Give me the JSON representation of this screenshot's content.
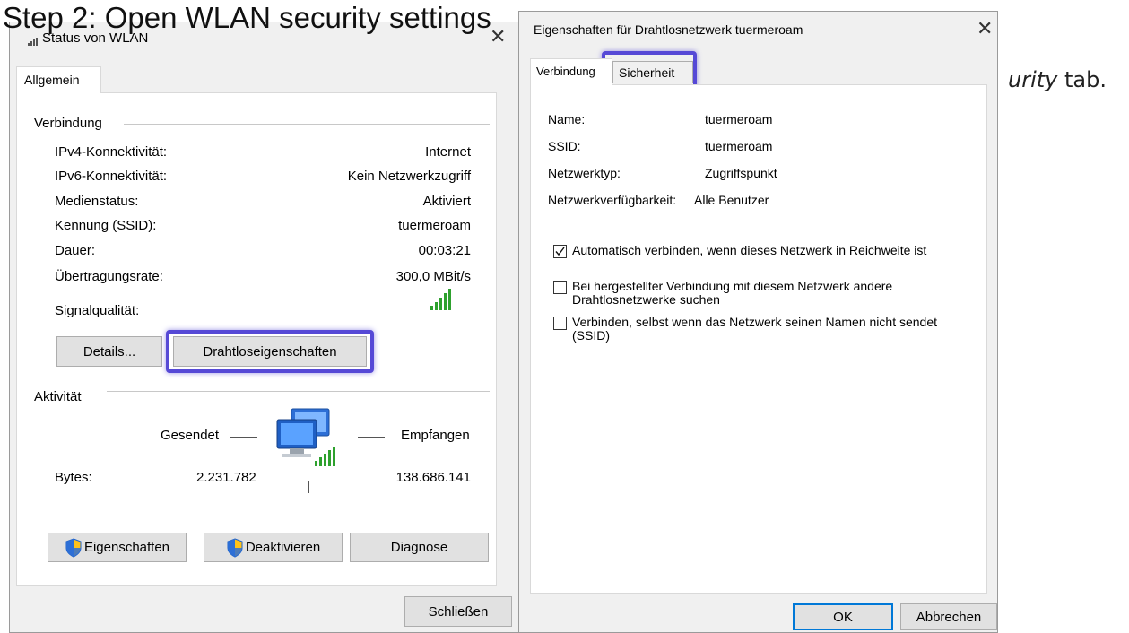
{
  "overlay": {
    "step_title": "Step 2: Open WLAN security settings",
    "caption_fragment": "urity",
    "caption_tail": "tab."
  },
  "status_window": {
    "title": "Status von WLAN",
    "tab": "Allgemein",
    "connection_heading": "Verbindung",
    "rows": [
      {
        "label": "IPv4-Konnektivität:",
        "value": "Internet"
      },
      {
        "label": "IPv6-Konnektivität:",
        "value": "Kein Netzwerkzugriff"
      },
      {
        "label": "Medienstatus:",
        "value": "Aktiviert"
      },
      {
        "label": "Kennung (SSID):",
        "value": "tuermeroam"
      },
      {
        "label": "Dauer:",
        "value": "00:03:21"
      },
      {
        "label": "Übertragungsrate:",
        "value": "300,0 MBit/s"
      }
    ],
    "signal_label": "Signalqualität:",
    "details_button": "Details...",
    "wireless_props_button": "Drahtloseigenschaften",
    "activity_heading": "Aktivität",
    "sent_label": "Gesendet",
    "received_label": "Empfangen",
    "bytes_label": "Bytes:",
    "bytes_sent": "2.231.782",
    "bytes_received": "138.686.141",
    "properties_button": "Eigenschaften",
    "disable_button": "Deaktivieren",
    "diagnose_button": "Diagnose",
    "close_button": "Schließen"
  },
  "props_window": {
    "title": "Eigenschaften für Drahtlosnetzwerk tuermeroam",
    "tab_connection": "Verbindung",
    "tab_security": "Sicherheit",
    "fields": [
      {
        "label": "Name:",
        "value": "tuermeroam"
      },
      {
        "label": "SSID:",
        "value": "tuermeroam"
      },
      {
        "label": "Netzwerktyp:",
        "value": "Zugriffspunkt"
      },
      {
        "label": "Netzwerkverfügbarkeit:",
        "value": "Alle Benutzer"
      }
    ],
    "options": [
      {
        "text": "Automatisch verbinden, wenn dieses Netzwerk in Reichweite ist",
        "checked": true
      },
      {
        "text": "Bei hergestellter Verbindung mit diesem Netzwerk andere Drahtlosnetzwerke suchen",
        "checked": false
      },
      {
        "text": "Verbinden, selbst wenn das Netzwerk seinen Namen nicht sendet (SSID)",
        "checked": false
      }
    ],
    "ok_button": "OK",
    "cancel_button": "Abbrechen"
  },
  "colors": {
    "highlight": "#5649d6",
    "signal_green": "#2ea12e"
  }
}
